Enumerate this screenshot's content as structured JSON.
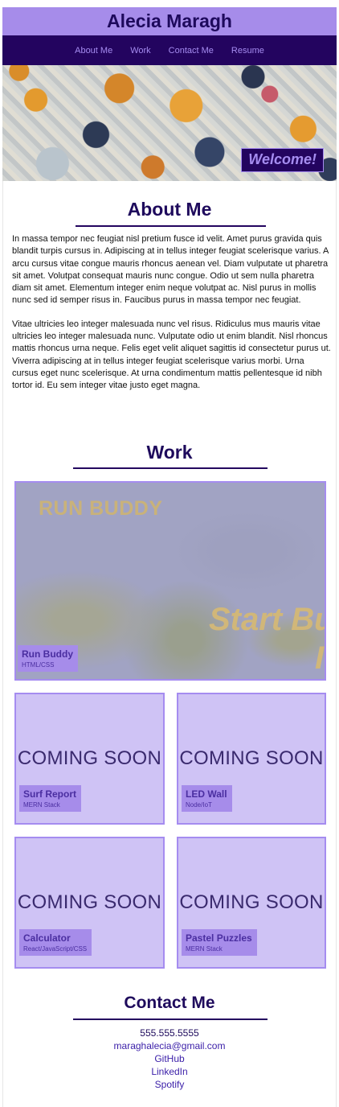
{
  "header": {
    "title": "Alecia Maragh"
  },
  "nav": {
    "items": [
      "About Me",
      "Work",
      "Contact Me",
      "Resume"
    ]
  },
  "hero": {
    "badge": "Welcome!"
  },
  "about": {
    "heading": "About Me",
    "paragraphs": [
      "In massa tempor nec feugiat nisl pretium fusce id velit. Amet purus gravida quis blandit turpis cursus in. Adipiscing at in tellus integer feugiat scelerisque varius. A arcu cursus vitae congue mauris rhoncus aenean vel. Diam vulputate ut pharetra sit amet. Volutpat consequat mauris nunc congue. Odio ut sem nulla pharetra diam sit amet. Elementum integer enim neque volutpat ac. Nisl purus in mollis nunc sed id semper risus in. Faucibus purus in massa tempor nec feugiat.",
      "Vitae ultricies leo integer malesuada nunc vel risus. Ridiculus mus mauris vitae ultricies leo integer malesuada nunc. Vulputate odio ut enim blandit. Nisl rhoncus mattis rhoncus urna neque. Felis eget velit aliquet sagittis id consectetur purus ut. Viverra adipiscing at in tellus integer feugiat scelerisque varius morbi. Urna cursus eget nunc scelerisque. At urna condimentum mattis pellentesque id nibh tortor id. Eu sem integer vitae justo eget magna."
    ]
  },
  "work": {
    "heading": "Work",
    "featured": {
      "image_title": "RUN BUDDY",
      "image_tagline_1": "Start Bu",
      "image_tagline_2": "I",
      "title": "Run Buddy",
      "stack": "HTML/CSS"
    },
    "cards": [
      {
        "placeholder": "COMING SOON",
        "title": "Surf Report",
        "stack": "MERN Stack"
      },
      {
        "placeholder": "COMING SOON",
        "title": "LED Wall",
        "stack": "Node/IoT"
      },
      {
        "placeholder": "COMING SOON",
        "title": "Calculator",
        "stack": "React/JavaScript/CSS"
      },
      {
        "placeholder": "COMING SOON",
        "title": "Pastel Puzzles",
        "stack": "MERN Stack"
      }
    ]
  },
  "contact": {
    "heading": "Contact Me",
    "phone": "555.555.5555",
    "email": "maraghalecia@gmail.com",
    "links": [
      "GitHub",
      "LinkedIn",
      "Spotify"
    ]
  },
  "colors": {
    "header_bg": "#a68cea",
    "nav_bg": "#23045f",
    "accent": "#a58cf0",
    "card_bg": "#cfc3f5",
    "heading": "#1e0a5c"
  }
}
